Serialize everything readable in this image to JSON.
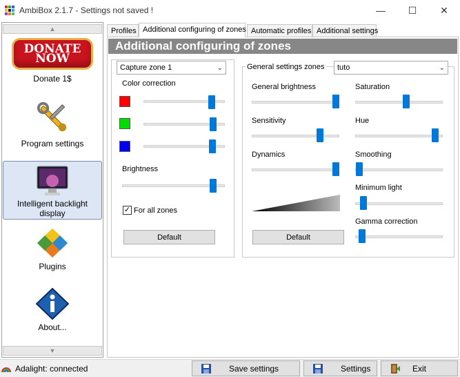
{
  "window": {
    "title": "AmbiBox 2.1.7  - Settings not saved !",
    "minimize": "—",
    "maximize": "☐",
    "close": "✕"
  },
  "sidebar": {
    "scroll_up": "▲",
    "scroll_down": "▼",
    "items": [
      {
        "label": "Donate 1$",
        "icon": "donate-now-badge",
        "badge_text": "DONATE NOW"
      },
      {
        "label": "Program settings",
        "icon": "wrench-screwdriver-icon"
      },
      {
        "label": "Intelligent backlight display",
        "icon": "monitor-icon",
        "selected": true
      },
      {
        "label": "Plugins",
        "icon": "puzzle-icon"
      },
      {
        "label": "About...",
        "icon": "info-icon"
      }
    ]
  },
  "tabs": [
    "Profiles",
    "Additional configuring of zones",
    "Automatic profiles",
    "Additional settings"
  ],
  "active_tab": 1,
  "header": "Additional configuring of zones",
  "left_group": {
    "zone_select": "Capture zone 1",
    "color_correction_label": "Color correction",
    "colors": [
      {
        "name": "red",
        "hex": "#ff0000",
        "level": 0.93
      },
      {
        "name": "green",
        "hex": "#00dd00",
        "level": 0.95
      },
      {
        "name": "blue",
        "hex": "#0000ee",
        "level": 0.94
      }
    ],
    "brightness_label": "Brightness",
    "brightness_level": 0.95,
    "all_zones_label": "For all zones",
    "all_zones_checked": true,
    "default_button": "Default"
  },
  "right_group": {
    "title": "General settings zones",
    "profile_select": "tuto",
    "sliders_left": [
      {
        "label": "General brightness",
        "level": 0.95
      },
      {
        "label": "Sensitivity",
        "level": 0.77
      },
      {
        "label": "Dynamics",
        "level": 0.95
      }
    ],
    "sliders_right": [
      {
        "label": "Saturation",
        "level": 0.57
      },
      {
        "label": "Hue",
        "level": 0.92
      },
      {
        "label": "Smoothing",
        "level": 0.0
      },
      {
        "label": "Minimum light",
        "level": 0.05
      },
      {
        "label": "Gamma correction",
        "level": 0.03
      }
    ],
    "default_button": "Default"
  },
  "status": {
    "text": "Adalight: connected",
    "save_button": "Save settings",
    "settings_button": "Settings",
    "exit_button": "Exit"
  },
  "colors": {
    "accent": "#0078d7",
    "header_band": "#878787",
    "selected_item": "#dde6f5"
  }
}
